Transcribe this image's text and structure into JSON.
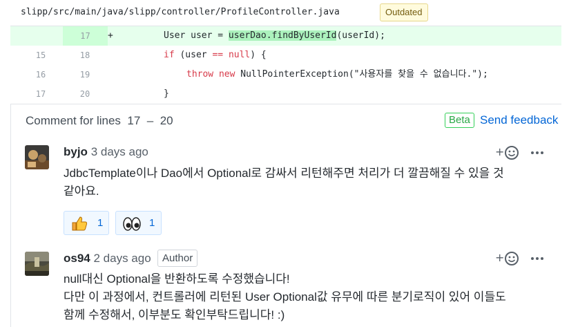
{
  "file": {
    "path": "slipp/src/main/java/slipp/controller/ProfileController.java",
    "status_badge": "Outdated"
  },
  "diff": {
    "rows": [
      {
        "old": "",
        "new": "17",
        "marker": "+"
      },
      {
        "old": "15",
        "new": "18",
        "marker": ""
      },
      {
        "old": "16",
        "new": "19",
        "marker": ""
      },
      {
        "old": "17",
        "new": "20",
        "marker": ""
      }
    ],
    "code": {
      "line1_a": "User user = ",
      "line1_hl": "userDao.findByUserId",
      "line1_b": "(userId);",
      "line2_kw": "if",
      "line2_a": " (user ",
      "line2_op": "==",
      "line2_b": " ",
      "line2_null": "null",
      "line2_c": ") {",
      "line3_throw": "throw",
      "line3_new": "new",
      "line3_rest": " NullPointerException(\"사용자를 찾을 수 없습니다.\");",
      "line4": "}"
    }
  },
  "comment_thread": {
    "heading_prefix": "Comment for lines",
    "line_start": "17",
    "line_sep": "–",
    "line_end": "20",
    "beta_label": "Beta",
    "feedback_link": "Send feedback",
    "comments": [
      {
        "author": "byjo",
        "time": "3 days ago",
        "body_lines": [
          "JdbcTemplate이나 Dao에서 Optional로 감싸서 리턴해주면 처리가 더 깔끔해질 수 있을 것",
          "같아요."
        ],
        "reactions": [
          {
            "icon": "thumbs-up-icon",
            "count": "1"
          },
          {
            "icon": "eyes-icon",
            "count": "1"
          }
        ]
      },
      {
        "author": "os94",
        "time": "2 days ago",
        "badge": "Author",
        "body_lines": [
          "null대신 Optional을 반환하도록 수정했습니다!",
          "다만 이 과정에서, 컨트롤러에 리턴된 User Optional값 유무에 따른 분기로직이 있어 이들도",
          "함께 수정해서, 이부분도 확인부탁드립니다! :)"
        ]
      }
    ]
  },
  "colors": {
    "added_bg": "#e6ffed",
    "added_gutter": "#cdffd8",
    "highlight": "#acf2bd",
    "keyword": "#d73a49",
    "link": "#0366d6",
    "beta": "#28a745"
  }
}
